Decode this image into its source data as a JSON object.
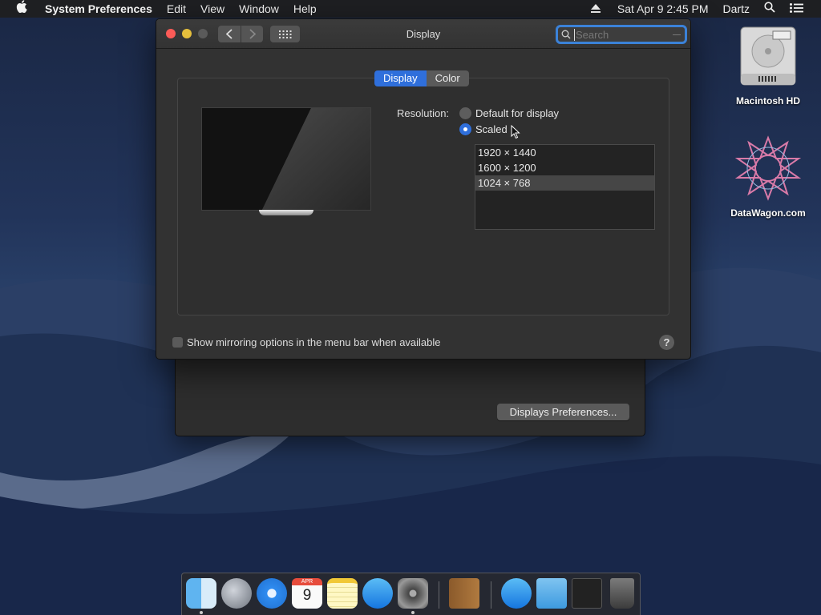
{
  "menubar": {
    "apple_icon": "apple-logo",
    "app_name": "System Preferences",
    "menus": [
      "Edit",
      "View",
      "Window",
      "Help"
    ],
    "status": {
      "eject_icon": "eject-icon",
      "datetime": "Sat Apr 9  2:45 PM",
      "user": "Dartz",
      "search_icon": "spotlight-icon",
      "list_icon": "notification-center-icon"
    }
  },
  "desktop": {
    "icons": [
      {
        "label": "Macintosh HD",
        "icon": "hard-drive-icon"
      },
      {
        "label": "DataWagon.com",
        "icon": "datawagon-logo-icon"
      }
    ]
  },
  "main_window": {
    "title": "Display",
    "search": {
      "placeholder": "Search",
      "value": ""
    },
    "tabs": [
      {
        "label": "Display",
        "active": true
      },
      {
        "label": "Color",
        "active": false
      }
    ],
    "resolution": {
      "label": "Resolution:",
      "options": [
        {
          "label": "Default for display",
          "selected": false
        },
        {
          "label": "Scaled",
          "selected": true
        }
      ],
      "list": [
        {
          "label": "1920 × 1440",
          "selected": false
        },
        {
          "label": "1600 × 1200",
          "selected": false
        },
        {
          "label": "1024 × 768",
          "selected": true
        }
      ]
    },
    "mirroring_checkbox": {
      "label": "Show mirroring options in the menu bar when available",
      "checked": false
    },
    "help_label": "?"
  },
  "back_window": {
    "button_label": "Displays Preferences..."
  },
  "dock": {
    "apps": [
      "finder-icon",
      "launchpad-icon",
      "safari-icon",
      "calendar-icon",
      "notes-icon",
      "app-store-icon",
      "system-preferences-icon",
      "contacts-icon",
      "app-store-icon",
      "downloads-folder-icon",
      "screenshot-icon",
      "trash-icon"
    ],
    "calendar": {
      "month": "APR",
      "day": "9"
    }
  },
  "colors": {
    "accent": "#2f6fdb",
    "close": "#fc5b57",
    "minimize": "#e5bf3c"
  }
}
